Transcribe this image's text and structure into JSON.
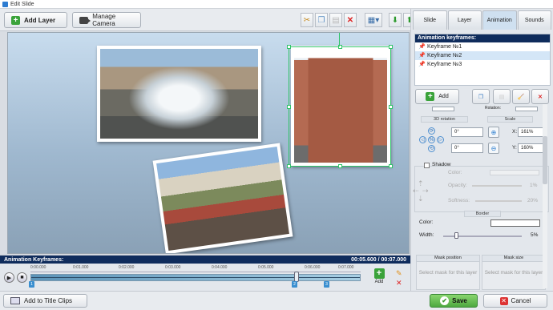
{
  "window": {
    "title": "Edit Slide"
  },
  "toolbar": {
    "add_layer_label": "Add Layer",
    "manage_camera_label": "Manage Camera"
  },
  "keyframes_panel": {
    "title": "Animation Keyframes:",
    "time_display": "00:05.600 / 00:07.000",
    "ruler_ticks": [
      "0:00.000",
      "0:01.000",
      "0:02.000",
      "0:03.000",
      "0:04.000",
      "0:05.000",
      "0:06.000",
      "0:07.000"
    ],
    "markers": [
      "1",
      "2",
      "3"
    ],
    "add_label": "Add"
  },
  "bottom": {
    "add_title_clips_label": "Add to Title Clips",
    "save_label": "Save",
    "cancel_label": "Cancel"
  },
  "right_panel": {
    "tabs": [
      "Slide",
      "Layer",
      "Animation",
      "Sounds"
    ],
    "active_tab": "Animation",
    "keyframes_header": "Animation keyframes:",
    "keyframes": [
      "Keyframe №1",
      "Keyframe №2",
      "Keyframe №3"
    ],
    "selected_keyframe": "Keyframe №2",
    "add_label": "Add",
    "rotation_label": "Rotation:",
    "rotation_3d_label": "3D rotation",
    "scale_label": "Scale",
    "rot_x": "0°",
    "rot_y": "0°",
    "scale_x_label": "X:",
    "scale_x": "161%",
    "scale_y_label": "Y:",
    "scale_y": "160%",
    "shadow_label": "Shadow",
    "shadow_color_label": "Color:",
    "shadow_opacity_label": "Opacity:",
    "shadow_opacity": "1%",
    "shadow_softness_label": "Softness:",
    "shadow_softness": "20%",
    "border_label": "Border",
    "border_color_label": "Color:",
    "border_width_label": "Width:",
    "border_width": "5%",
    "mask_position_label": "Mask position",
    "mask_position_text": "Select mask for this layer",
    "mask_size_label": "Mask size",
    "mask_size_text": "Select mask for this layer"
  },
  "colors": {
    "accent_navy": "#0f2c5c",
    "selection_green": "#31c46a",
    "add_green": "#3aa33a",
    "delete_red": "#d33333"
  }
}
